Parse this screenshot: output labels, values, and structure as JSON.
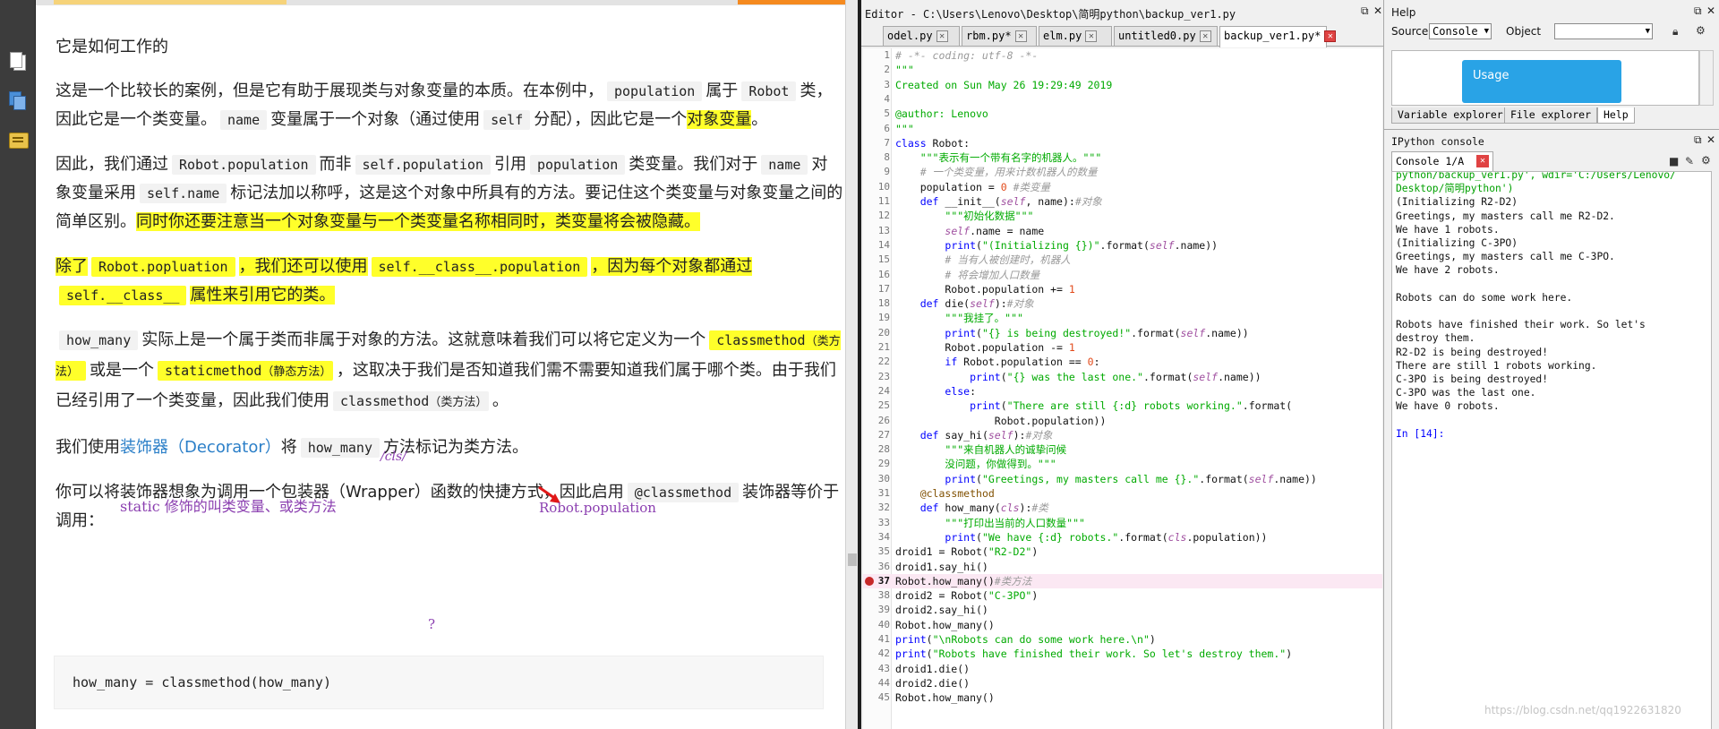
{
  "pdf_toolbar": {
    "icons": [
      "pages-icon",
      "layers-icon",
      "comments-icon"
    ]
  },
  "doc": {
    "heading": "它是如何工作的",
    "p1": {
      "t1": "这是一个比较长的案例，但是它有助于展现类与对象变量的本质。在本例中，",
      "c1": "population",
      "t2": "属于",
      "c2": "Robot",
      "t3": "类，因此它是一个类变量。",
      "c3": "name",
      "t4": "变量属于一个对象（通过使用",
      "c4": "self",
      "t5": "分配），因此它是一个",
      "hl": "对象变量",
      "t6": "。"
    },
    "p2": {
      "t1": "因此，我们通过",
      "c1": "Robot.population",
      "t2": "而非",
      "c2": "self.population",
      "t3": "引用",
      "c3": "population",
      "t4": "类变量。我们对于",
      "c4": "name",
      "t5": "对象变量采用",
      "c5": "self.name",
      "t6": "标记法加以称呼，这是这个对象中所具有的方法。要记住这个类变量与对象变量之间的简单区别。",
      "hl": "同时你还要注意当一个对象变量与一个类变量名称相同时，类变量将会被隐藏。"
    },
    "p3": {
      "t1": "除了",
      "c1": "Robot.popluation",
      "t2": "，我们还可以使用",
      "c2": "self.__class__.population",
      "t3": "，因为每个对象都通过",
      "c3": "self.__class__",
      "t4": "属性来引用它的类。"
    },
    "p4": {
      "c1": "how_many",
      "t1": "实际上是一个属于类而非属于对象的方法。这就意味着我们可以将它定义为一个",
      "c2": "classmethod",
      "c2_cn": "（类方法）",
      "t2": "或是一个",
      "c3": "staticmethod",
      "c3_cn": "（静态方法）",
      "t3": "，这取决于我们是否知道我们需不需要知道我们属于哪个类。由于我们已经引用了一个类变量，因此我们使用",
      "c4": "classmethod",
      "c4_cn": "（类方法）",
      "t4": "。"
    },
    "p5": {
      "t1": "我们使用",
      "link": "装饰器（Decorator）",
      "t2": "将",
      "c1": "how_many",
      "t3": "方法标记为类方法。"
    },
    "p6": {
      "t1": "你可以将装饰器想象为调用一个包装器（Wrapper）函数的快捷方式，因此启用",
      "c1": "@classmethod",
      "t2": "装饰器等价于调用："
    },
    "codeblock": "how_many = classmethod(how_many)",
    "annotations": {
      "static_note": "static 修饰的叫类变量、或类方法",
      "cls_note": "/cls/",
      "robot_pop": "Robot.population",
      "question": "?"
    }
  },
  "editor": {
    "title": "Editor - C:\\Users\\Lenovo\\Desktop\\简明python\\backup_ver1.py",
    "tabs": [
      {
        "label": "odel.py",
        "active": false
      },
      {
        "label": "rbm.py*",
        "active": false
      },
      {
        "label": "elm.py",
        "active": false
      },
      {
        "label": "untitled0.py",
        "active": false
      },
      {
        "label": "backup_ver1.py*",
        "active": true
      }
    ],
    "breakpoint_line": 37,
    "lines": [
      {
        "n": "1",
        "html": "<span class='c-cm'># -*- coding: utf-8 -*-</span>"
      },
      {
        "n": "2",
        "html": "<span class='c-str'>\"\"\"</span>"
      },
      {
        "n": "3",
        "html": "<span class='c-str'>Created on Sun May 26 19:29:49 2019</span>"
      },
      {
        "n": "4",
        "html": ""
      },
      {
        "n": "5",
        "html": "<span class='c-str'>@author: Lenovo</span>"
      },
      {
        "n": "6",
        "html": "<span class='c-str'>\"\"\"</span>"
      },
      {
        "n": "7",
        "html": "<span class='c-kw'>class</span> Robot:"
      },
      {
        "n": "8",
        "html": "    <span class='c-str'>\"\"\"表示有一个带有名字的机器人。\"\"\"</span>"
      },
      {
        "n": "9",
        "html": "    <span class='c-cm'># 一个类变量，用来计数机器人的数量</span>"
      },
      {
        "n": "10",
        "html": "    population = <span class='c-num'>0</span> <span class='c-cm'>#类变量</span>"
      },
      {
        "n": "11",
        "html": "    <span class='c-kw'>def</span> __init__(<span class='c-self'>self</span>, name):<span class='c-cm'>#对象</span>"
      },
      {
        "n": "12",
        "html": "        <span class='c-str'>\"\"\"初始化数据\"\"\"</span>"
      },
      {
        "n": "13",
        "html": "        <span class='c-self'>self</span>.name = name"
      },
      {
        "n": "14",
        "html": "        <span class='c-kw'>print</span>(<span class='c-str'>\"(Initializing {})\"</span>.format(<span class='c-self'>self</span>.name))"
      },
      {
        "n": "15",
        "html": "        <span class='c-cm'># 当有人被创建时，机器人</span>"
      },
      {
        "n": "16",
        "html": "        <span class='c-cm'># 将会增加人口数量</span>"
      },
      {
        "n": "17",
        "html": "        Robot.population += <span class='c-num'>1</span>"
      },
      {
        "n": "18",
        "html": "    <span class='c-kw'>def</span> die(<span class='c-self'>self</span>):<span class='c-cm'>#对象</span>"
      },
      {
        "n": "19",
        "html": "        <span class='c-str'>\"\"\"我挂了。\"\"\"</span>"
      },
      {
        "n": "20",
        "html": "        <span class='c-kw'>print</span>(<span class='c-str'>\"{} is being destroyed!\"</span>.format(<span class='c-self'>self</span>.name))"
      },
      {
        "n": "21",
        "html": "        Robot.population -= <span class='c-num'>1</span>"
      },
      {
        "n": "22",
        "html": "        <span class='c-kw'>if</span> Robot.population == <span class='c-num'>0</span>:"
      },
      {
        "n": "23",
        "html": "            <span class='c-kw'>print</span>(<span class='c-str'>\"{} was the last one.\"</span>.format(<span class='c-self'>self</span>.name))"
      },
      {
        "n": "24",
        "html": "        <span class='c-kw'>else</span>:"
      },
      {
        "n": "25",
        "html": "            <span class='c-kw'>print</span>(<span class='c-str'>\"There are still {:d} robots working.\"</span>.format("
      },
      {
        "n": "26",
        "html": "                Robot.population))"
      },
      {
        "n": "27",
        "html": "    <span class='c-kw'>def</span> say_hi(<span class='c-self'>self</span>):<span class='c-cm'>#对象</span>"
      },
      {
        "n": "28",
        "html": "        <span class='c-str'>\"\"\"来自机器人的诚挚问候</span>"
      },
      {
        "n": "29",
        "html": "<span class='c-str'>        没问题，你做得到。\"\"\"</span>"
      },
      {
        "n": "30",
        "html": "        <span class='c-kw'>print</span>(<span class='c-str'>\"Greetings, my masters call me {}.\"</span>.format(<span class='c-self'>self</span>.name))"
      },
      {
        "n": "31",
        "html": "    <span class='c-dec'>@classmethod</span>"
      },
      {
        "n": "32",
        "html": "    <span class='c-kw'>def</span> how_many(<span class='c-self'>cls</span>):<span class='c-cm'>#类</span>"
      },
      {
        "n": "33",
        "html": "        <span class='c-str'>\"\"\"打印出当前的人口数量\"\"\"</span>"
      },
      {
        "n": "34",
        "html": "        <span class='c-kw'>print</span>(<span class='c-str'>\"We have {:d} robots.\"</span>.format(<span class='c-self'>cls</span>.population))"
      },
      {
        "n": "35",
        "html": "droid1 = Robot(<span class='c-str'>\"R2-D2\"</span>)"
      },
      {
        "n": "36",
        "html": "droid1.say_hi()"
      },
      {
        "n": "37",
        "html": "Robot.how_many()<span class='c-cm'>#类方法</span>"
      },
      {
        "n": "38",
        "html": "droid2 = Robot(<span class='c-str'>\"C-3PO\"</span>)"
      },
      {
        "n": "39",
        "html": "droid2.say_hi()"
      },
      {
        "n": "40",
        "html": "Robot.how_many()"
      },
      {
        "n": "41",
        "html": "<span class='c-kw'>print</span>(<span class='c-str'>\"\\nRobots can do some work here.\\n\"</span>)"
      },
      {
        "n": "42",
        "html": "<span class='c-kw'>print</span>(<span class='c-str'>\"Robots have finished their work. So let's destroy them.\"</span>)"
      },
      {
        "n": "43",
        "html": "droid1.die()"
      },
      {
        "n": "44",
        "html": "droid2.die()"
      },
      {
        "n": "45",
        "html": "Robot.how_many()"
      }
    ]
  },
  "help": {
    "title": "Help",
    "source_label": "Source",
    "source_value": "Console",
    "object_label": "Object",
    "object_value": "",
    "usage_label": "Usage",
    "tabs": [
      {
        "label": "Variable explorer",
        "active": false
      },
      {
        "label": "File explorer",
        "active": false
      },
      {
        "label": "Help",
        "active": true
      }
    ]
  },
  "console": {
    "title": "IPython console",
    "tab_label": "Console 1/A",
    "lines": [
      {
        "text": "python/backup_ver1.py', wdir='C:/Users/Lenovo/",
        "cls": "green"
      },
      {
        "text": "Desktop/简明python')",
        "cls": "green"
      },
      {
        "text": "(Initializing R2-D2)",
        "cls": ""
      },
      {
        "text": "Greetings, my masters call me R2-D2.",
        "cls": ""
      },
      {
        "text": "We have 1 robots.",
        "cls": ""
      },
      {
        "text": "(Initializing C-3PO)",
        "cls": ""
      },
      {
        "text": "Greetings, my masters call me C-3PO.",
        "cls": ""
      },
      {
        "text": "We have 2 robots.",
        "cls": ""
      },
      {
        "text": "",
        "cls": ""
      },
      {
        "text": "Robots can do some work here.",
        "cls": ""
      },
      {
        "text": "",
        "cls": ""
      },
      {
        "text": "Robots have finished their work. So let's",
        "cls": ""
      },
      {
        "text": "destroy them.",
        "cls": ""
      },
      {
        "text": "R2-D2 is being destroyed!",
        "cls": ""
      },
      {
        "text": "There are still 1 robots working.",
        "cls": ""
      },
      {
        "text": "C-3PO is being destroyed!",
        "cls": ""
      },
      {
        "text": "C-3PO was the last one.",
        "cls": ""
      },
      {
        "text": "We have 0 robots.",
        "cls": ""
      },
      {
        "text": "",
        "cls": ""
      },
      {
        "text": "In [14]:",
        "cls": "prompt"
      }
    ]
  },
  "watermark": "https://blog.csdn.net/qq1922631820"
}
